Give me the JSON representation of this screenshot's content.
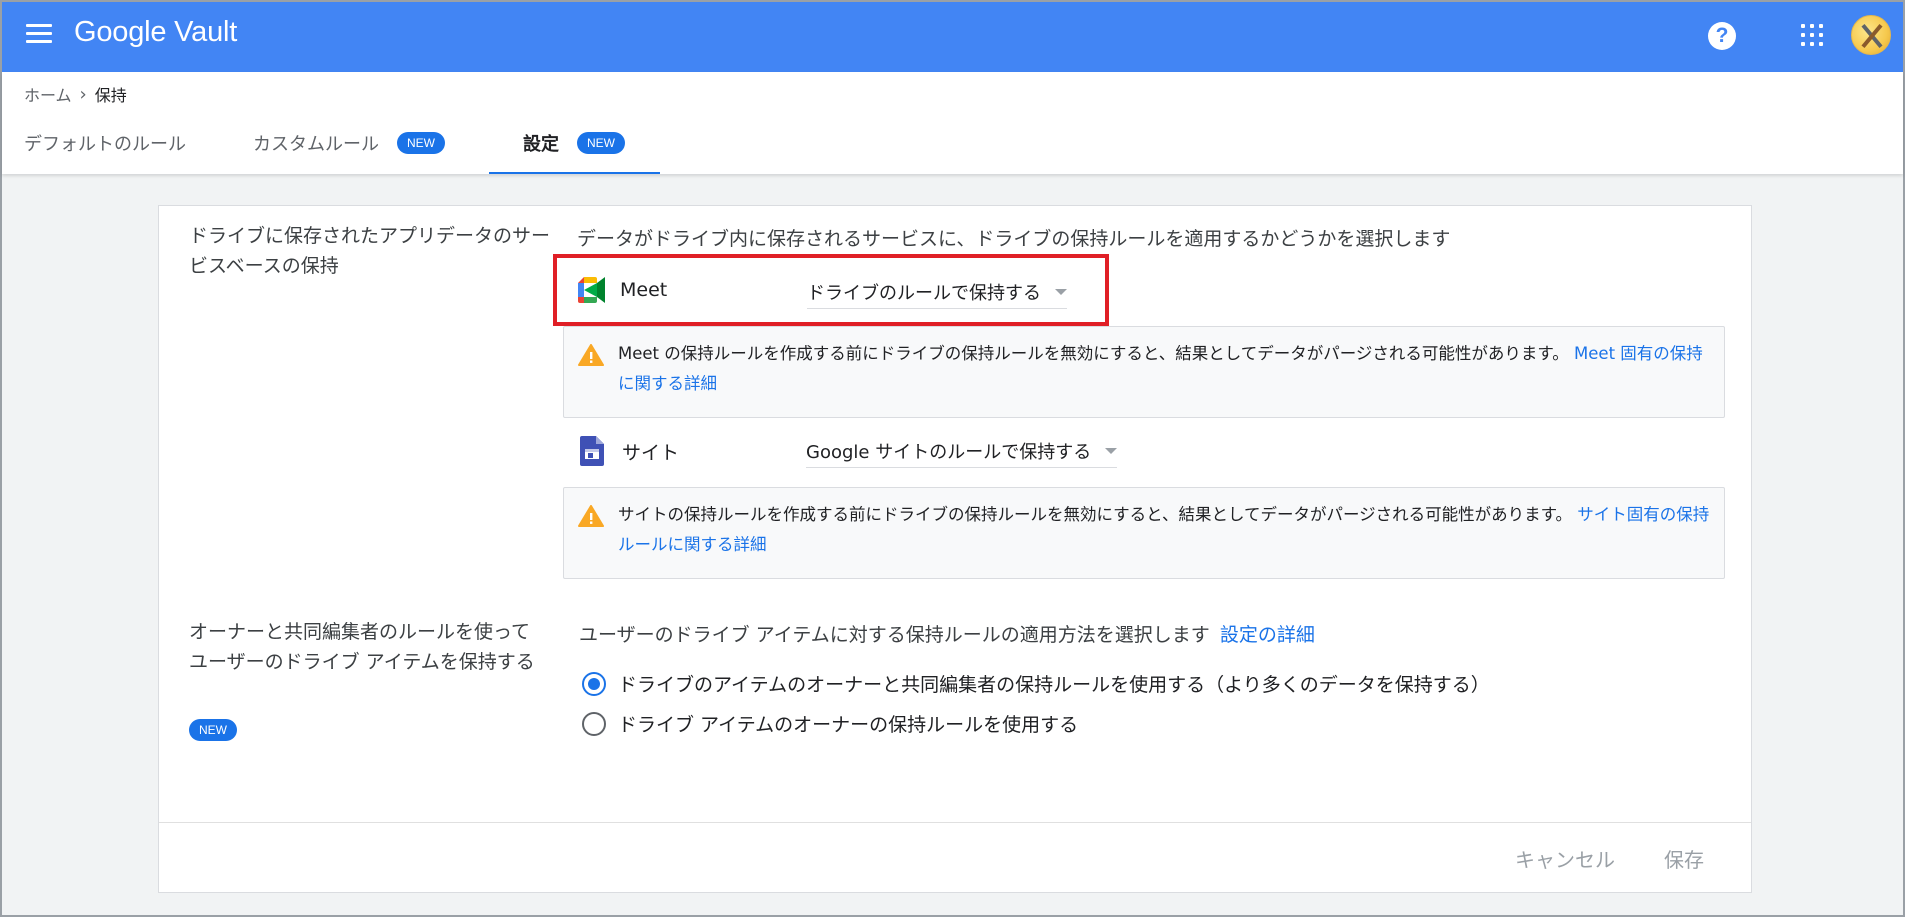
{
  "app": {
    "title": "Google Vault"
  },
  "breadcrumb": {
    "home": "ホーム",
    "current": "保持"
  },
  "tabs": [
    {
      "label": "デフォルトのルール",
      "badge": ""
    },
    {
      "label": "カスタムルール",
      "badge": "NEW"
    },
    {
      "label": "設定",
      "badge": "NEW",
      "active": true
    }
  ],
  "section1": {
    "label": "ドライブに保存されたアプリデータのサービスベースの保持",
    "description": "データがドライブ内に保存されるサービスに、ドライブの保持ルールを適用するかどうかを選択します",
    "meet": {
      "name": "Meet",
      "selected": "ドライブのルールで保持する",
      "alert_text": "Meet の保持ルールを作成する前にドライブの保持ルールを無効にすると、結果としてデータがパージされる可能性があります。",
      "alert_link": "Meet 固有の保持に関する詳細"
    },
    "sites": {
      "name": "サイト",
      "selected": "Google サイトのルールで保持する",
      "alert_text": "サイトの保持ルールを作成する前にドライブの保持ルールを無効にすると、結果としてデータがパージされる可能性があります。",
      "alert_link": "サイト固有の保持ルールに関する詳細"
    }
  },
  "section2": {
    "label": "オーナーと共同編集者のルールを使ってユーザーのドライブ アイテムを保持する",
    "badge": "NEW",
    "description": "ユーザーのドライブ アイテムに対する保持ルールの適用方法を選択します",
    "description_link": "設定の詳細",
    "options": [
      {
        "label": "ドライブのアイテムのオーナーと共同編集者の保持ルールを使用する（より多くのデータを保持する）",
        "checked": true
      },
      {
        "label": "ドライブ アイテムのオーナーの保持ルールを使用する",
        "checked": false
      }
    ]
  },
  "footer": {
    "cancel": "キャンセル",
    "save": "保存"
  },
  "colors": {
    "topbar": "#4285f4",
    "accent": "#1a73e8",
    "highlight": "#e01f26",
    "warning": "#f9a825"
  }
}
